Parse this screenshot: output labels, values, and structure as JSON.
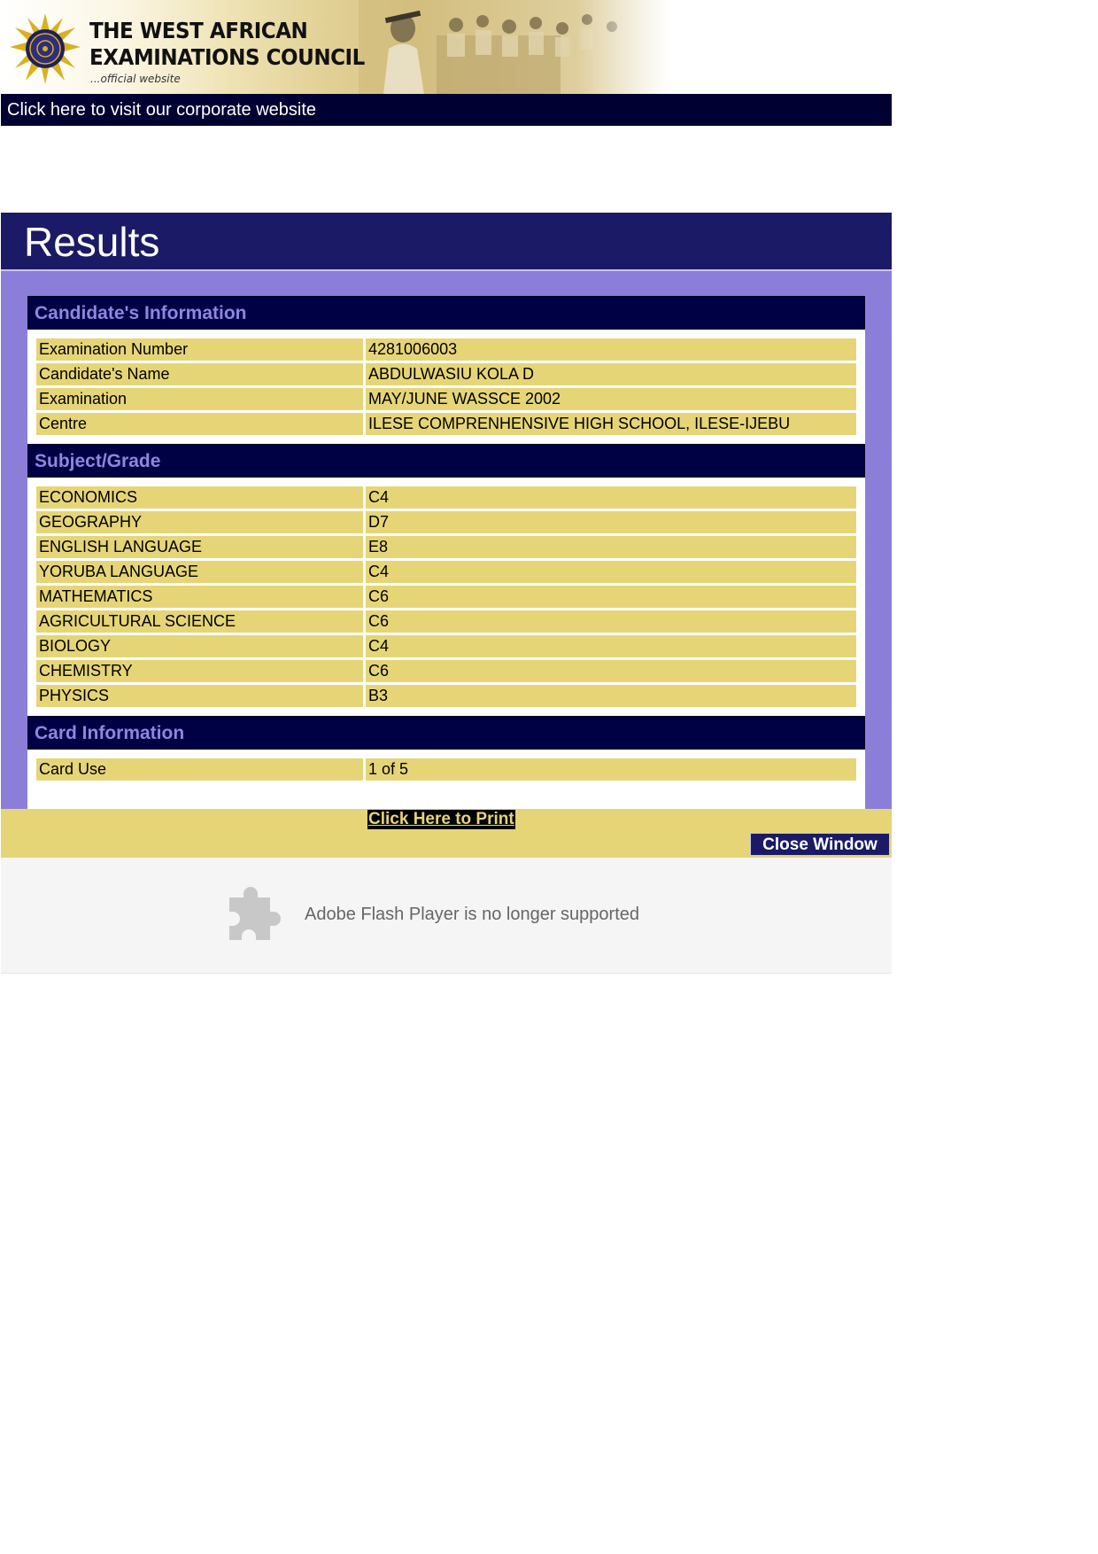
{
  "header": {
    "brand_line1": "THE WEST AFRICAN",
    "brand_line2": "EXAMINATIONS COUNCIL",
    "brand_sub": "...official website",
    "corporate_link": "Click here to visit our corporate website"
  },
  "results": {
    "title": "Results",
    "candidate_section": "Candidate's Information",
    "candidate_info": [
      {
        "label": "Examination Number",
        "value": "4281006003"
      },
      {
        "label": "Candidate's Name",
        "value": "ABDULWASIU KOLA D"
      },
      {
        "label": "Examination",
        "value": "MAY/JUNE WASSCE 2002"
      },
      {
        "label": "Centre",
        "value": "ILESE COMPRENHENSIVE HIGH SCHOOL, ILESE-IJEBU"
      }
    ],
    "subject_section": "Subject/Grade",
    "subjects": [
      {
        "label": "ECONOMICS",
        "value": "C4"
      },
      {
        "label": "GEOGRAPHY",
        "value": "D7"
      },
      {
        "label": "ENGLISH LANGUAGE",
        "value": "E8"
      },
      {
        "label": "YORUBA LANGUAGE",
        "value": "C4"
      },
      {
        "label": "MATHEMATICS",
        "value": "C6"
      },
      {
        "label": "AGRICULTURAL SCIENCE",
        "value": "C6"
      },
      {
        "label": "BIOLOGY",
        "value": "C4"
      },
      {
        "label": "CHEMISTRY",
        "value": "C6"
      },
      {
        "label": "PHYSICS",
        "value": "B3"
      }
    ],
    "card_section": "Card Information",
    "card_info": [
      {
        "label": "Card Use",
        "value": "1 of 5"
      }
    ]
  },
  "actions": {
    "print_label": "Click Here to Print",
    "close_label": "Close Window"
  },
  "flash": {
    "message": "Adobe Flash Player is no longer supported",
    "icon": "puzzle-piece-icon"
  },
  "colors": {
    "navy": "#000044",
    "header_blue": "#1a1a66",
    "purple": "#8b7ed8",
    "row_yellow": "#e6d577"
  }
}
